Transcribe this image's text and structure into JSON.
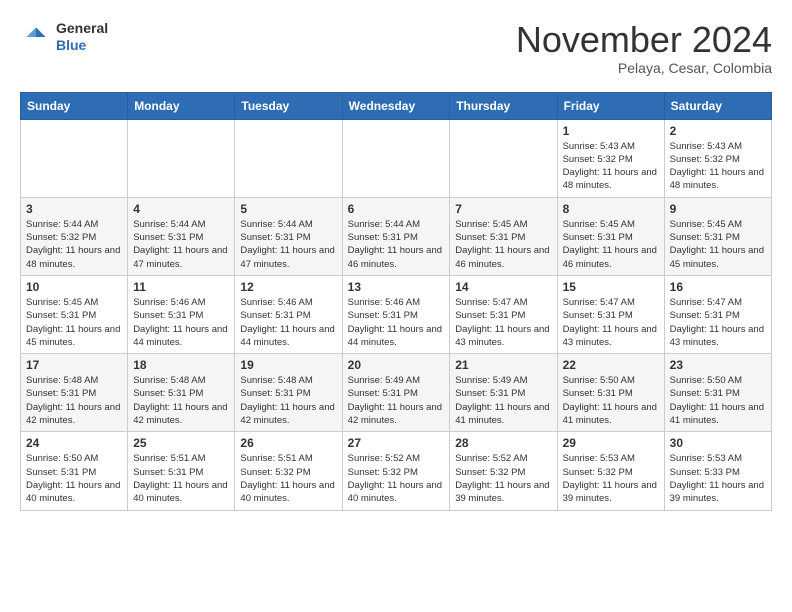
{
  "header": {
    "logo": {
      "general": "General",
      "blue": "Blue"
    },
    "month": "November 2024",
    "location": "Pelaya, Cesar, Colombia"
  },
  "weekdays": [
    "Sunday",
    "Monday",
    "Tuesday",
    "Wednesday",
    "Thursday",
    "Friday",
    "Saturday"
  ],
  "weeks": [
    [
      {
        "day": "",
        "info": ""
      },
      {
        "day": "",
        "info": ""
      },
      {
        "day": "",
        "info": ""
      },
      {
        "day": "",
        "info": ""
      },
      {
        "day": "",
        "info": ""
      },
      {
        "day": "1",
        "info": "Sunrise: 5:43 AM\nSunset: 5:32 PM\nDaylight: 11 hours and 48 minutes."
      },
      {
        "day": "2",
        "info": "Sunrise: 5:43 AM\nSunset: 5:32 PM\nDaylight: 11 hours and 48 minutes."
      }
    ],
    [
      {
        "day": "3",
        "info": "Sunrise: 5:44 AM\nSunset: 5:32 PM\nDaylight: 11 hours and 48 minutes."
      },
      {
        "day": "4",
        "info": "Sunrise: 5:44 AM\nSunset: 5:31 PM\nDaylight: 11 hours and 47 minutes."
      },
      {
        "day": "5",
        "info": "Sunrise: 5:44 AM\nSunset: 5:31 PM\nDaylight: 11 hours and 47 minutes."
      },
      {
        "day": "6",
        "info": "Sunrise: 5:44 AM\nSunset: 5:31 PM\nDaylight: 11 hours and 46 minutes."
      },
      {
        "day": "7",
        "info": "Sunrise: 5:45 AM\nSunset: 5:31 PM\nDaylight: 11 hours and 46 minutes."
      },
      {
        "day": "8",
        "info": "Sunrise: 5:45 AM\nSunset: 5:31 PM\nDaylight: 11 hours and 46 minutes."
      },
      {
        "day": "9",
        "info": "Sunrise: 5:45 AM\nSunset: 5:31 PM\nDaylight: 11 hours and 45 minutes."
      }
    ],
    [
      {
        "day": "10",
        "info": "Sunrise: 5:45 AM\nSunset: 5:31 PM\nDaylight: 11 hours and 45 minutes."
      },
      {
        "day": "11",
        "info": "Sunrise: 5:46 AM\nSunset: 5:31 PM\nDaylight: 11 hours and 44 minutes."
      },
      {
        "day": "12",
        "info": "Sunrise: 5:46 AM\nSunset: 5:31 PM\nDaylight: 11 hours and 44 minutes."
      },
      {
        "day": "13",
        "info": "Sunrise: 5:46 AM\nSunset: 5:31 PM\nDaylight: 11 hours and 44 minutes."
      },
      {
        "day": "14",
        "info": "Sunrise: 5:47 AM\nSunset: 5:31 PM\nDaylight: 11 hours and 43 minutes."
      },
      {
        "day": "15",
        "info": "Sunrise: 5:47 AM\nSunset: 5:31 PM\nDaylight: 11 hours and 43 minutes."
      },
      {
        "day": "16",
        "info": "Sunrise: 5:47 AM\nSunset: 5:31 PM\nDaylight: 11 hours and 43 minutes."
      }
    ],
    [
      {
        "day": "17",
        "info": "Sunrise: 5:48 AM\nSunset: 5:31 PM\nDaylight: 11 hours and 42 minutes."
      },
      {
        "day": "18",
        "info": "Sunrise: 5:48 AM\nSunset: 5:31 PM\nDaylight: 11 hours and 42 minutes."
      },
      {
        "day": "19",
        "info": "Sunrise: 5:48 AM\nSunset: 5:31 PM\nDaylight: 11 hours and 42 minutes."
      },
      {
        "day": "20",
        "info": "Sunrise: 5:49 AM\nSunset: 5:31 PM\nDaylight: 11 hours and 42 minutes."
      },
      {
        "day": "21",
        "info": "Sunrise: 5:49 AM\nSunset: 5:31 PM\nDaylight: 11 hours and 41 minutes."
      },
      {
        "day": "22",
        "info": "Sunrise: 5:50 AM\nSunset: 5:31 PM\nDaylight: 11 hours and 41 minutes."
      },
      {
        "day": "23",
        "info": "Sunrise: 5:50 AM\nSunset: 5:31 PM\nDaylight: 11 hours and 41 minutes."
      }
    ],
    [
      {
        "day": "24",
        "info": "Sunrise: 5:50 AM\nSunset: 5:31 PM\nDaylight: 11 hours and 40 minutes."
      },
      {
        "day": "25",
        "info": "Sunrise: 5:51 AM\nSunset: 5:31 PM\nDaylight: 11 hours and 40 minutes."
      },
      {
        "day": "26",
        "info": "Sunrise: 5:51 AM\nSunset: 5:32 PM\nDaylight: 11 hours and 40 minutes."
      },
      {
        "day": "27",
        "info": "Sunrise: 5:52 AM\nSunset: 5:32 PM\nDaylight: 11 hours and 40 minutes."
      },
      {
        "day": "28",
        "info": "Sunrise: 5:52 AM\nSunset: 5:32 PM\nDaylight: 11 hours and 39 minutes."
      },
      {
        "day": "29",
        "info": "Sunrise: 5:53 AM\nSunset: 5:32 PM\nDaylight: 11 hours and 39 minutes."
      },
      {
        "day": "30",
        "info": "Sunrise: 5:53 AM\nSunset: 5:33 PM\nDaylight: 11 hours and 39 minutes."
      }
    ]
  ]
}
